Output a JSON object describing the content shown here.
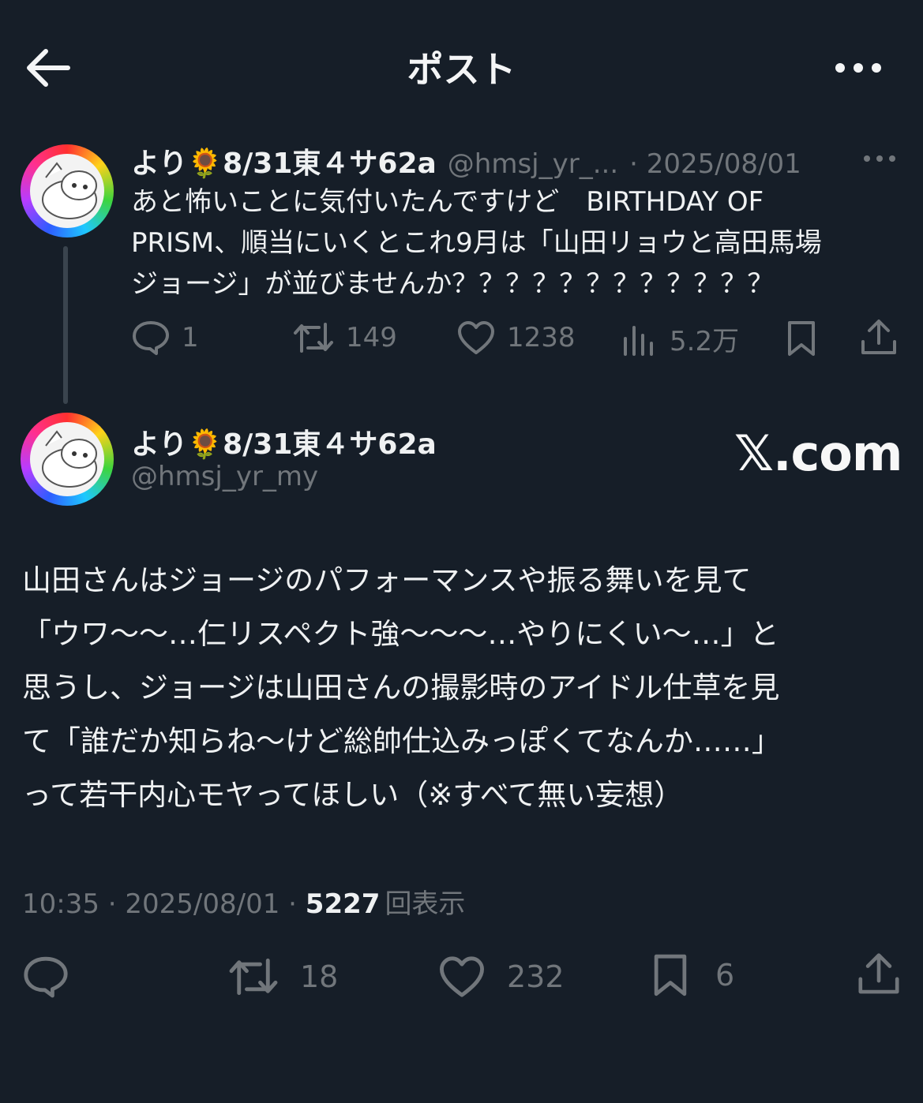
{
  "header": {
    "title": "ポスト"
  },
  "reply_to": {
    "name": "より🌻8/31東４サ62a",
    "handle": "@hmsj_yr_...",
    "date": "· 2025/08/01",
    "text_line1": "あと怖いことに気付いたんですけど　BIRTHDAY OF",
    "text_line2": "PRISM、順当にいくとこれ9月は「山田リョウと高田馬場",
    "text_line3": "ジョージ」が並びませんか？？？？？？？？？？？？",
    "stats": {
      "replies": "1",
      "reposts": "149",
      "likes": "1238",
      "views": "5.2万"
    }
  },
  "main": {
    "name": "より🌻8/31東４サ62a",
    "handle": "@hmsj_yr_my",
    "brand": "𝕏.com",
    "text_lines": [
      "山田さんはジョージのパフォーマンスや振る舞いを見て",
      "「ウワ〜〜…仁リスペクト強〜〜〜…やりにくい〜…」と",
      "思うし、ジョージは山田さんの撮影時のアイドル仕草を見",
      "て「誰だか知らね〜けど総帥仕込みっぽくてなんか……」",
      "って若干内心モヤってほしい（※すべて無い妄想）"
    ],
    "meta_time": "10:35 · 2025/08/01 · ",
    "meta_views": "5227",
    "meta_views_label": "回表示",
    "stats": {
      "reposts": "18",
      "likes": "232",
      "bookmarks": "6"
    }
  }
}
